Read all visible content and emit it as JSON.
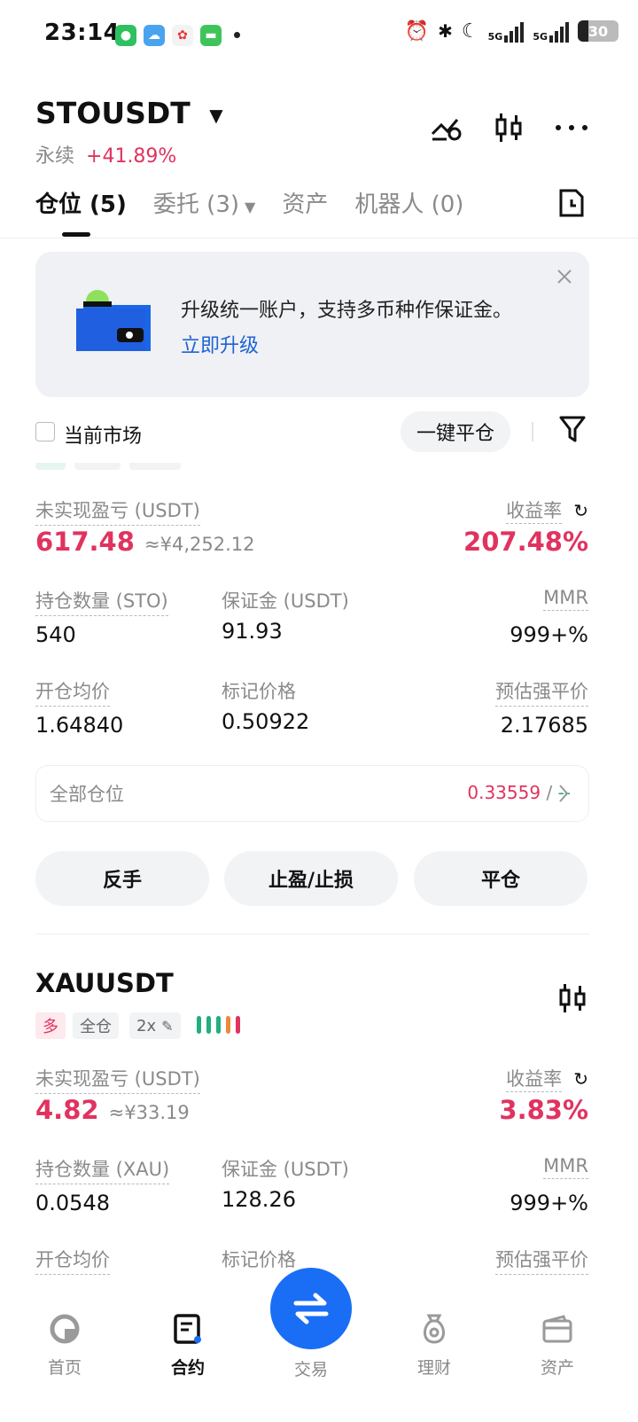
{
  "status_bar": {
    "time": "23:14",
    "battery": "30",
    "net1": "5G",
    "net2": "5G"
  },
  "header": {
    "symbol": "STOUSDT",
    "type": "永续",
    "change": "+41.89%"
  },
  "tabs": [
    {
      "label": "仓位 (5)"
    },
    {
      "label": "委托 (3)"
    },
    {
      "label": "资产"
    },
    {
      "label": "机器人 (0)"
    }
  ],
  "banner": {
    "text": "升级统一账户，支持多币种作保证金。",
    "link": "立即升级"
  },
  "filter": {
    "current_market": "当前市场",
    "close_all": "一键平仓"
  },
  "position1": {
    "upnl_label": "未实现盈亏 (USDT)",
    "upnl": "617.48",
    "upnl_cny": "≈¥4,252.12",
    "roe_label": "收益率",
    "roe": "207.48%",
    "qty_label": "持仓数量 (STO)",
    "qty": "540",
    "margin_label": "保证金 (USDT)",
    "margin": "91.93",
    "mmr_label": "MMR",
    "mmr": "999+%",
    "entry_label": "开仓均价",
    "entry": "1.64840",
    "mark_label": "标记价格",
    "mark": "0.50922",
    "liq_label": "预估强平价",
    "liq": "2.17685",
    "all_positions_label": "全部仓位",
    "all_positions_value": "0.33559",
    "all_positions_sep": "/",
    "all_positions_dash": "--",
    "btn_reverse": "反手",
    "btn_tpsl": "止盈/止损",
    "btn_close": "平仓"
  },
  "position2": {
    "symbol": "XAUUSDT",
    "tag_side": "多",
    "tag_mode": "全仓",
    "tag_lev": "2x",
    "upnl_label": "未实现盈亏 (USDT)",
    "upnl": "4.82",
    "upnl_cny": "≈¥33.19",
    "roe_label": "收益率",
    "roe": "3.83%",
    "qty_label": "持仓数量 (XAU)",
    "qty": "0.0548",
    "margin_label": "保证金 (USDT)",
    "margin": "128.26",
    "mmr_label": "MMR",
    "mmr": "999+%",
    "entry_label": "开仓均价",
    "mark_label": "标记价格",
    "liq_label": "预估强平价"
  },
  "bottom_nav": [
    {
      "label": "首页",
      "icon": "home-icon"
    },
    {
      "label": "合约",
      "icon": "contract-icon"
    },
    {
      "label": "交易",
      "icon": "swap-icon"
    },
    {
      "label": "理财",
      "icon": "earn-icon"
    },
    {
      "label": "资产",
      "icon": "wallet-icon"
    }
  ],
  "colors": {
    "red": "#e0335f",
    "orange": "#f0883a",
    "blue": "#1a6ef5",
    "green": "#1fb07c"
  }
}
